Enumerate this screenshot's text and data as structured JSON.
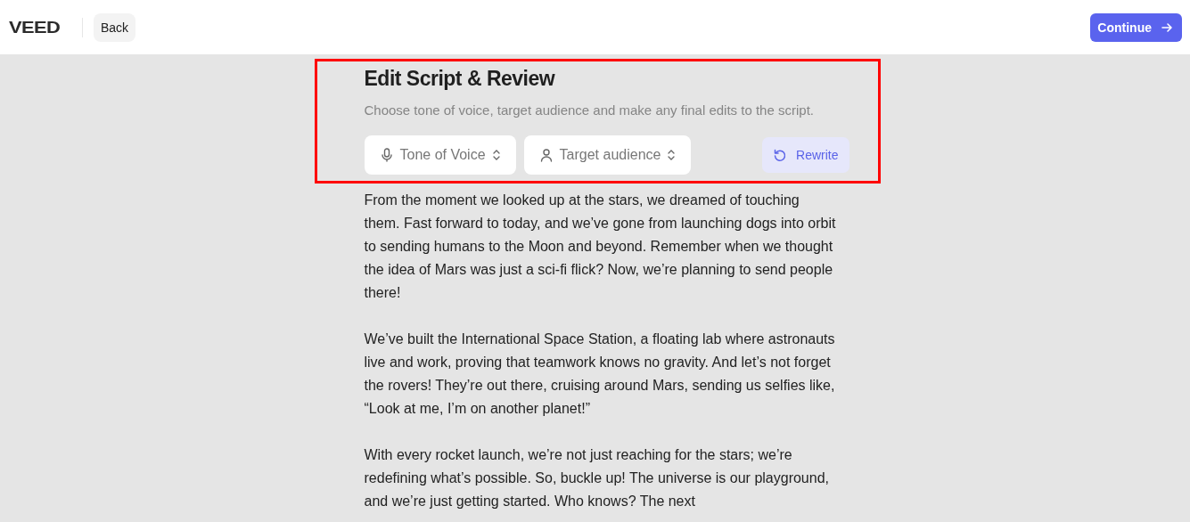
{
  "header": {
    "logo": "VEED",
    "back": "Back",
    "continue": "Continue"
  },
  "title": "Edit Script & Review",
  "subtitle": "Choose tone of voice, target audience and make any final edits to the script.",
  "controls": [
    {
      "kind": "mic",
      "label": "Tone of Voice"
    },
    {
      "kind": "person",
      "label": "Target audience"
    }
  ],
  "rewrite": "Rewrite",
  "paragraphs": [
    "From the moment we looked up at the stars, we dreamed of touching them. Fast forward to today, and we’ve gone from launching dogs into orbit to sending humans to the Moon and beyond. Remember when we thought the idea of Mars was just a sci-fi flick? Now, we’re planning to send people there!",
    "We’ve built the International Space Station, a floating lab where astronauts live and work, proving that teamwork knows no gravity. And let’s not forget the rovers! They’re out there, cruising around Mars, sending us selfies like, “Look at me, I’m on another planet!”",
    "With every rocket launch, we’re not just reaching for the stars; we’re redefining what’s possible. So, buckle up! The universe is our playground, and we’re just getting started. Who knows? The next"
  ]
}
